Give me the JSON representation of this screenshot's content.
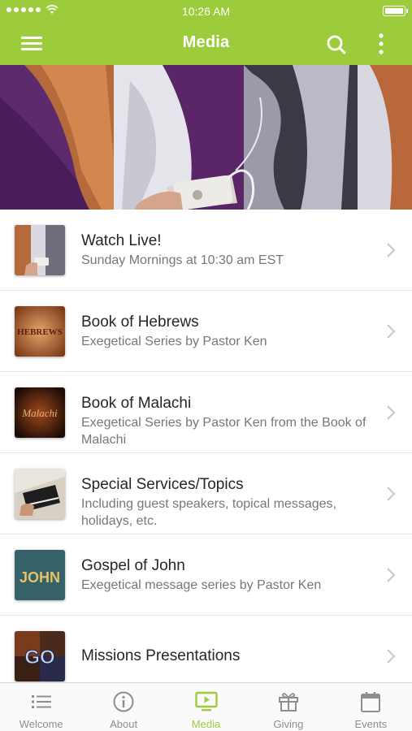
{
  "status_bar": {
    "time": "10:26 AM"
  },
  "header": {
    "title": "Media"
  },
  "media_items": [
    {
      "title": "Watch Live!",
      "subtitle": "Sunday Mornings at 10:30 am EST",
      "thumb": "phone-photo"
    },
    {
      "title": "Book of Hebrews",
      "subtitle": "Exegetical Series by Pastor Ken",
      "thumb_text": "HEBREWS"
    },
    {
      "title": "Book of Malachi",
      "subtitle": "Exegetical Series by Pastor Ken from the Book of Malachi",
      "thumb_text": "Malachi"
    },
    {
      "title": "Special Services/Topics",
      "subtitle": "Including guest speakers, topical messages, holidays, etc.",
      "thumb": "bible-photo"
    },
    {
      "title": "Gospel of John",
      "subtitle": "Exegetical message series by Pastor Ken",
      "thumb_text": "JOHN"
    },
    {
      "title": "Missions Presentations",
      "subtitle": "",
      "thumb_text": "GO"
    }
  ],
  "tabs": [
    {
      "label": "Welcome",
      "icon": "list-icon",
      "active": false
    },
    {
      "label": "About",
      "icon": "info-icon",
      "active": false
    },
    {
      "label": "Media",
      "icon": "tv-play-icon",
      "active": true
    },
    {
      "label": "Giving",
      "icon": "gift-icon",
      "active": false
    },
    {
      "label": "Events",
      "icon": "calendar-icon",
      "active": false
    }
  ],
  "colors": {
    "accent": "#9ccc3c",
    "tab_inactive": "#8e8e8e",
    "subtitle": "#777777"
  }
}
